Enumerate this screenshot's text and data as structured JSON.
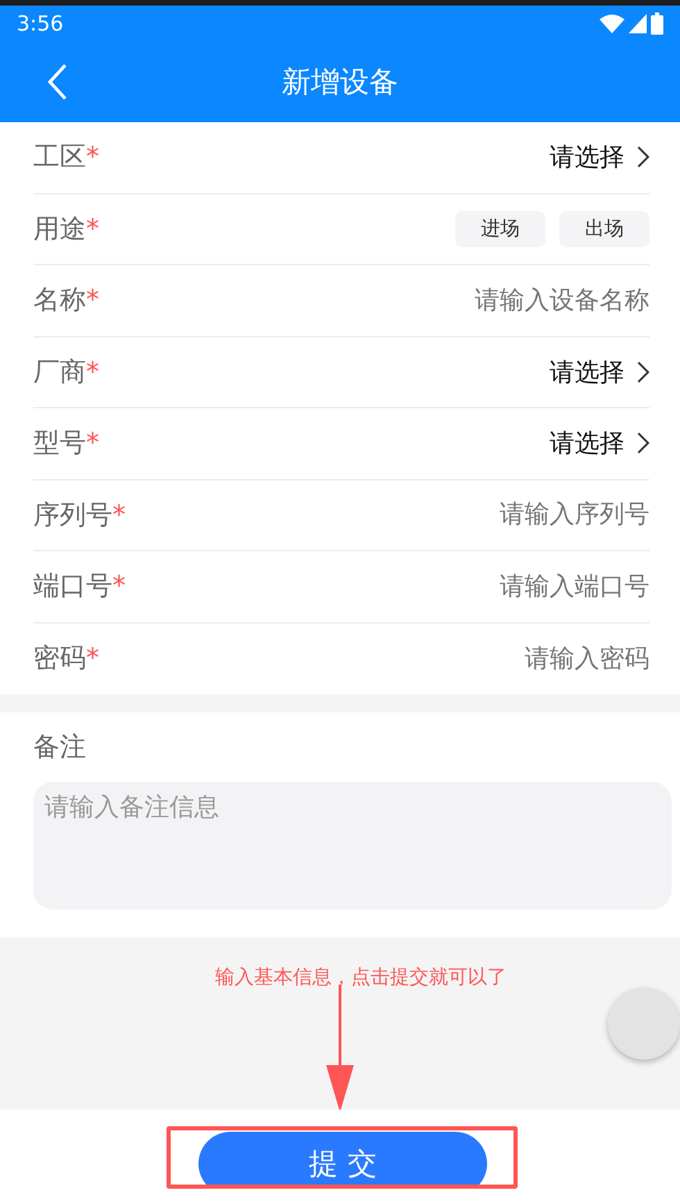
{
  "status_bar": {
    "time": "3:56"
  },
  "app_bar": {
    "title": "新增设备"
  },
  "fields": [
    {
      "kind": "select",
      "label": "工区",
      "required_mark": "*",
      "value": "请选择"
    },
    {
      "kind": "choice",
      "label": "用途",
      "required_mark": "*",
      "options": [
        {
          "label": "进场",
          "selected": false
        },
        {
          "label": "出场",
          "selected": false
        }
      ]
    },
    {
      "kind": "input",
      "label": "名称",
      "required_mark": "*",
      "placeholder": "请输入设备名称"
    },
    {
      "kind": "select",
      "label": "厂商",
      "required_mark": "*",
      "value": "请选择"
    },
    {
      "kind": "select",
      "label": "型号",
      "required_mark": "*",
      "value": "请选择"
    },
    {
      "kind": "input",
      "label": "序列号",
      "required_mark": "*",
      "placeholder": "请输入序列号"
    },
    {
      "kind": "input",
      "label": "端口号",
      "required_mark": "*",
      "placeholder": "请输入端口号"
    },
    {
      "kind": "input",
      "label": "密码",
      "required_mark": "*",
      "placeholder": "请输入密码"
    }
  ],
  "remark": {
    "label": "备注",
    "placeholder": "请输入备注信息"
  },
  "annotation": {
    "text": "输入基本信息，点击提交就可以了"
  },
  "submit_button": {
    "label": "提 交"
  }
}
